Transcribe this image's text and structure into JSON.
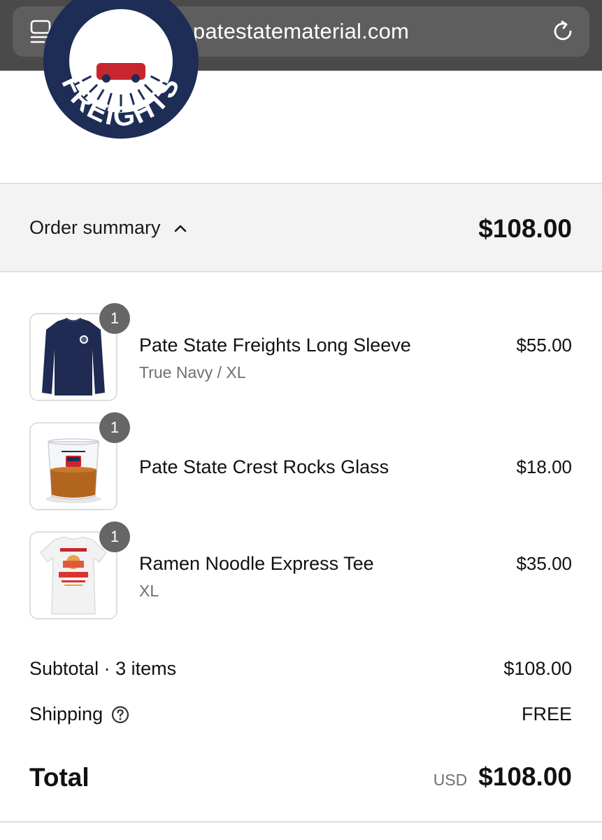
{
  "browser": {
    "url": "patestatematerial.com",
    "reader_icon": "reader-mode-icon",
    "reload_icon": "reload-icon"
  },
  "logo": {
    "text": "FREIGHTS",
    "colors": {
      "navy": "#1d2d55",
      "red": "#c8262f",
      "white": "#ffffff"
    }
  },
  "summary": {
    "label": "Order summary",
    "chevron_icon": "chevron-up-icon",
    "total": "$108.00"
  },
  "items": [
    {
      "qty": "1",
      "name": "Pate State Freights Long Sleeve",
      "variant": "True Navy / XL",
      "price": "$55.00",
      "image": "navy-sweatshirt"
    },
    {
      "qty": "1",
      "name": "Pate State Crest Rocks Glass",
      "variant": "",
      "price": "$18.00",
      "image": "rocks-glass"
    },
    {
      "qty": "1",
      "name": "Ramen Noodle Express Tee",
      "variant": "XL",
      "price": "$35.00",
      "image": "white-tee"
    }
  ],
  "totals": {
    "subtotal_label": "Subtotal · 3 items",
    "subtotal_value": "$108.00",
    "shipping_label": "Shipping",
    "shipping_help_icon": "question-circle-icon",
    "shipping_value": "FREE",
    "total_label": "Total",
    "currency": "USD",
    "total_value": "$108.00"
  }
}
